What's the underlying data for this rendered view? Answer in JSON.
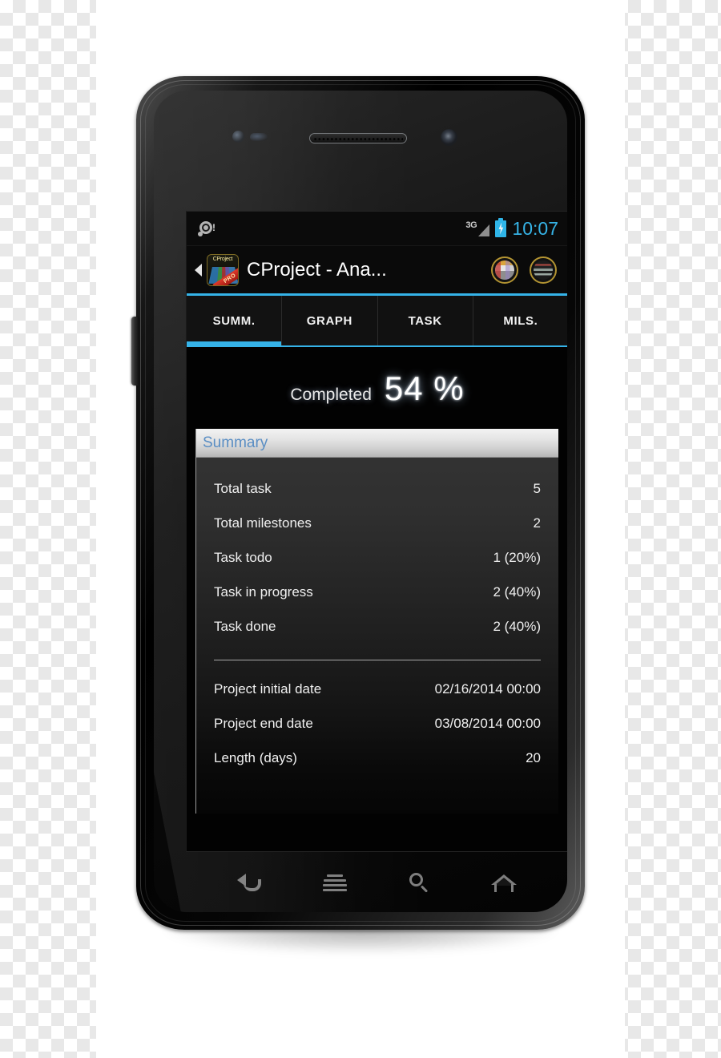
{
  "status_bar": {
    "alarm_icon": "alarm-warning-icon",
    "network_label": "3G",
    "signal_icon": "signal-triangle-icon",
    "battery_icon": "battery-charging-icon",
    "clock": "10:07"
  },
  "action_bar": {
    "up_icon": "up-caret-icon",
    "app_icon": {
      "name": "cproject-app-icon",
      "title": "CProject",
      "ribbon": "PRO"
    },
    "title": "CProject - Ana...",
    "actions": [
      {
        "name": "gantt-view-button",
        "icon": "gantt-circle-icon"
      },
      {
        "name": "list-view-button",
        "icon": "list-circle-icon"
      }
    ],
    "accent_color": "#35b3e8"
  },
  "tabs": {
    "items": [
      {
        "label": "SUMM.",
        "active": true
      },
      {
        "label": "GRAPH",
        "active": false
      },
      {
        "label": "TASK",
        "active": false
      },
      {
        "label": "MILS.",
        "active": false
      }
    ],
    "indicator_color": "#35b3e8"
  },
  "content": {
    "completed": {
      "label": "Completed",
      "value": "54 %"
    },
    "card": {
      "title": "Summary",
      "title_color": "#5a8ec4",
      "stats": [
        {
          "label": "Total task",
          "value": "5"
        },
        {
          "label": "Total milestones",
          "value": "2"
        },
        {
          "label": "Task todo",
          "value": "1 (20%)"
        },
        {
          "label": "Task in progress",
          "value": "2 (40%)"
        },
        {
          "label": "Task done",
          "value": "2 (40%)"
        }
      ],
      "dates": [
        {
          "label": "Project initial date",
          "value": "02/16/2014 00:00"
        },
        {
          "label": "Project end date",
          "value": "03/08/2014 00:00"
        },
        {
          "label": "Length (days)",
          "value": "20"
        }
      ]
    }
  },
  "nav_bar": {
    "buttons": [
      {
        "name": "back-button",
        "icon": "back-arrow-icon"
      },
      {
        "name": "menu-button",
        "icon": "menu-lines-icon"
      },
      {
        "name": "search-button",
        "icon": "search-icon"
      },
      {
        "name": "home-button",
        "icon": "home-icon"
      }
    ]
  },
  "device": {
    "speaker": "earpiece-speaker",
    "front_camera": "front-camera-icon",
    "proximity_sensor": "proximity-sensor-icon",
    "volume_rocker": "volume-rocker-button"
  }
}
